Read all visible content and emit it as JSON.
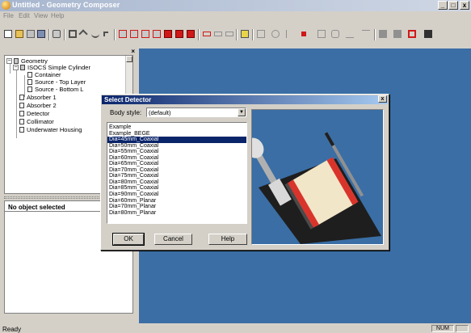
{
  "window": {
    "title": "Untitled - Geometry Composer",
    "minimize": "_",
    "maximize": "□",
    "close": "x"
  },
  "menu": {
    "items": [
      "File",
      "Edit",
      "View",
      "Help"
    ]
  },
  "tree": {
    "close_glyph": "×",
    "items": [
      {
        "label": "Geometry",
        "expander": "−",
        "icon": "geometry-icon"
      },
      {
        "label": "ISOCS Simple Cylinder",
        "expander": "−",
        "icon": "geometry-icon"
      },
      {
        "label": "Container",
        "icon": "component-icon"
      },
      {
        "label": "Source - Top Layer",
        "icon": "component-icon"
      },
      {
        "label": "Source - Bottom L",
        "icon": "component-icon"
      },
      {
        "label": "Absorber 1",
        "icon": "component-icon"
      },
      {
        "label": "Absorber 2",
        "icon": "component-icon"
      },
      {
        "label": "Detector",
        "icon": "component-icon"
      },
      {
        "label": "Collimator",
        "icon": "component-icon"
      },
      {
        "label": "Underwater Housing",
        "icon": "component-icon"
      }
    ]
  },
  "properties": {
    "heading": "No object selected"
  },
  "dialog": {
    "title": "Select Detector",
    "close_glyph": "x",
    "body_style_label": "Body style:",
    "body_style_value": "(default)",
    "dropdown_arrow": "▼",
    "detectors": [
      "Example",
      "Example_BEGE",
      "Dia=45mm_Coaxial",
      "Dia=50mm_Coaxial",
      "Dia=55mm_Coaxial",
      "Dia=60mm_Coaxial",
      "Dia=65mm_Coaxial",
      "Dia=70mm_Coaxial",
      "Dia=75mm_Coaxial",
      "Dia=80mm_Coaxial",
      "Dia=85mm_Coaxial",
      "Dia=90mm_Coaxial",
      "Dia=60mm_Planar",
      "Dia=70mm_Planar",
      "Dia=80mm_Planar"
    ],
    "selected_index": 2,
    "ok_label": "OK",
    "cancel_label": "Cancel",
    "help_label": "Help"
  },
  "status": {
    "text": "Ready",
    "num": "NUM"
  },
  "colors": {
    "workspace": "#3a6ea5",
    "selection": "#0a246a",
    "dialog_title": "#0a246a",
    "detector_band": "#d9342b",
    "detector_body": "#f2e6c8"
  }
}
